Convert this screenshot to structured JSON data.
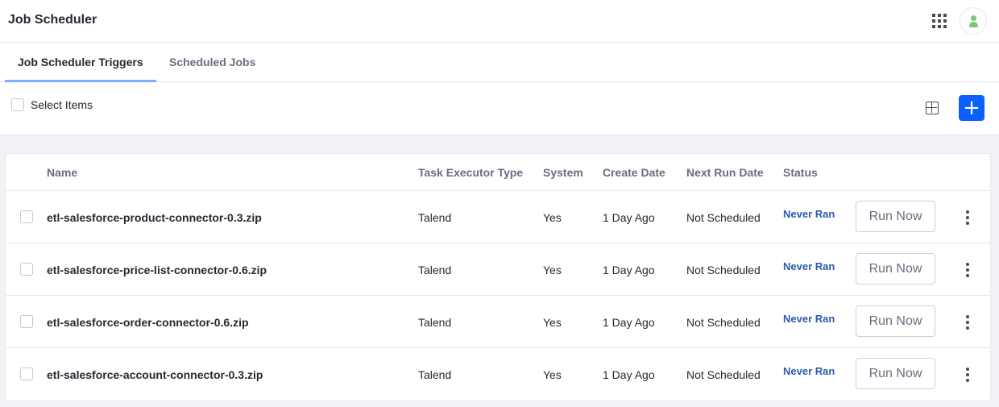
{
  "app": {
    "title": "Job Scheduler"
  },
  "header": {
    "apps_icon": "apps-grid-icon",
    "avatar_icon": "user-icon"
  },
  "tabs": [
    {
      "label": "Job Scheduler Triggers",
      "active": true
    },
    {
      "label": "Scheduled Jobs",
      "active": false
    }
  ],
  "toolbar": {
    "select_items_label": "Select Items",
    "view_icon": "grid-view-icon",
    "add_label": "+"
  },
  "table": {
    "columns": [
      "Name",
      "Task Executor Type",
      "System",
      "Create Date",
      "Next Run Date",
      "Status"
    ],
    "rows": [
      {
        "name": "etl-salesforce-product-connector-0.3.zip",
        "task_executor_type": "Talend",
        "system": "Yes",
        "create_date": "1 Day Ago",
        "next_run_date": "Not Scheduled",
        "status": "Never Ran",
        "action": "Run Now"
      },
      {
        "name": "etl-salesforce-price-list-connector-0.6.zip",
        "task_executor_type": "Talend",
        "system": "Yes",
        "create_date": "1 Day Ago",
        "next_run_date": "Not Scheduled",
        "status": "Never Ran",
        "action": "Run Now"
      },
      {
        "name": "etl-salesforce-order-connector-0.6.zip",
        "task_executor_type": "Talend",
        "system": "Yes",
        "create_date": "1 Day Ago",
        "next_run_date": "Not Scheduled",
        "status": "Never Ran",
        "action": "Run Now"
      },
      {
        "name": "etl-salesforce-account-connector-0.3.zip",
        "task_executor_type": "Talend",
        "system": "Yes",
        "create_date": "1 Day Ago",
        "next_run_date": "Not Scheduled",
        "status": "Never Ran",
        "action": "Run Now"
      }
    ]
  },
  "colors": {
    "accent": "#0b5fff",
    "status": "#2e5aac",
    "tab_indicator": "#80acff",
    "background": "#f1f2f5"
  }
}
